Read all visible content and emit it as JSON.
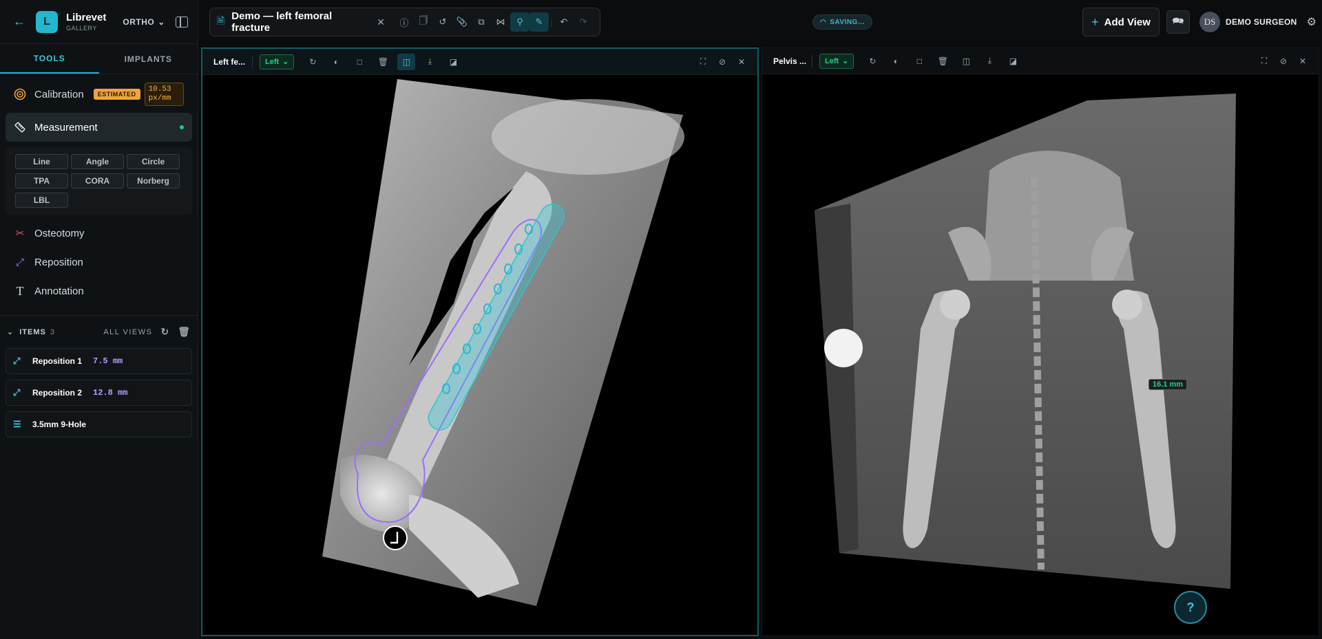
{
  "app": {
    "name": "Librevet",
    "subtitle": "GALLERY",
    "mode": "ORTHO"
  },
  "sidebar": {
    "tabs": [
      {
        "label": "TOOLS",
        "active": true
      },
      {
        "label": "IMPLANTS",
        "active": false
      }
    ],
    "calibration": {
      "label": "Calibration",
      "badge": "ESTIMATED",
      "value": "10.53 px/mm"
    },
    "measurement": {
      "label": "Measurement"
    },
    "measure_tools": [
      "Line",
      "Angle",
      "Circle",
      "TPA",
      "CORA",
      "Norberg",
      "LBL"
    ],
    "tools": [
      {
        "label": "Osteotomy",
        "icon": "scissors-icon"
      },
      {
        "label": "Reposition",
        "icon": "arrow-diagonal-icon"
      },
      {
        "label": "Annotation",
        "icon": "text-icon"
      }
    ],
    "items_header": {
      "label": "ITEMS",
      "count": "3",
      "scope": "ALL VIEWS"
    },
    "items": [
      {
        "label": "Reposition 1",
        "value": "7.5 mm",
        "icon": "arrow-diagonal-icon"
      },
      {
        "label": "Reposition 2",
        "value": "12.8 mm",
        "icon": "arrow-diagonal-icon"
      },
      {
        "label": "3.5mm 9-Hole",
        "value": "",
        "icon": "layers-icon"
      }
    ]
  },
  "document": {
    "title": "Demo — left femoral fracture"
  },
  "status": {
    "saving": "SAVING..."
  },
  "header": {
    "add_view": "Add View",
    "user_initials": "DS",
    "user_name": "DEMO SURGEON"
  },
  "viewers": [
    {
      "title": "Left fe...",
      "side": "Left"
    },
    {
      "title": "Pelvis ...",
      "side": "Left",
      "measurement_label": "16.1 mm"
    }
  ],
  "colors": {
    "accent": "#22b6cf",
    "calibration": "#f2a33a",
    "measure_value": "#b49cff",
    "side_tag": "#27d08a"
  }
}
